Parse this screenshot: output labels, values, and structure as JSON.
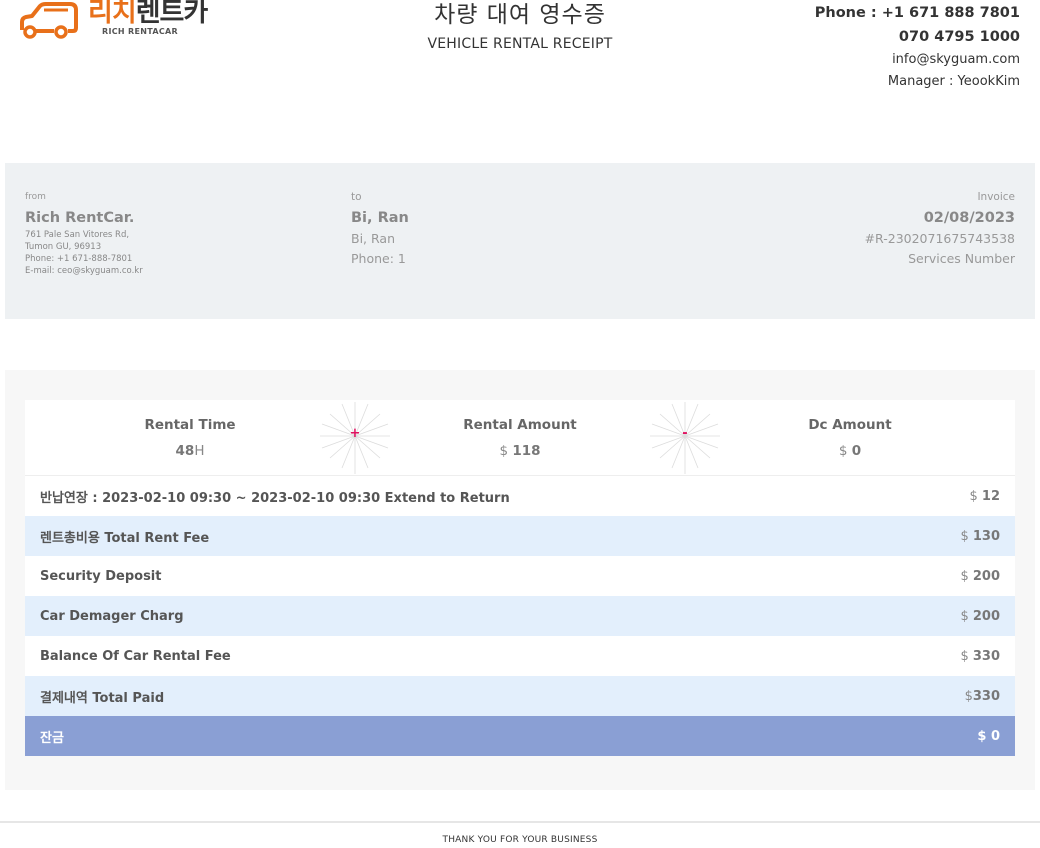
{
  "brand": {
    "name_ko_1": "리치",
    "name_ko_2": "렌트카",
    "name_en": "RICH RENTACAR",
    "accent": "#e8701a"
  },
  "header": {
    "title_ko": "차량 대여 영수증",
    "title_en": "VEHICLE RENTAL RECEIPT",
    "phone": "Phone : +1 671 888 7801",
    "phone2": "070 4795 1000",
    "email": "info@skyguam.com",
    "manager": "Manager : YeookKim"
  },
  "from": {
    "label": "from",
    "name": "Rich RentCar.",
    "address1": "761 Pale San Vitores Rd,",
    "address2": "Tumon GU, 96913",
    "phone": "Phone: +1 671-888-7801",
    "email": "E-mail: ceo@skyguam.co.kr"
  },
  "to": {
    "label": "to",
    "name": "Bi, Ran",
    "line1": "Bi, Ran",
    "phone": "Phone: 1"
  },
  "invoice": {
    "label": "Invoice",
    "date": "02/08/2023",
    "number": "#R-2302071675743538",
    "services": "Services Number"
  },
  "summary": {
    "rental_time_label": "Rental Time",
    "rental_time_value": "48",
    "rental_time_unit": "H",
    "plus": "+",
    "rental_amount_label": "Rental Amount",
    "rental_amount_currency": "$",
    "rental_amount_value": "118",
    "minus": "-",
    "dc_amount_label": "Dc Amount",
    "dc_amount_currency": "$",
    "dc_amount_value": "0"
  },
  "rows": [
    {
      "label": "반납연장 : 2023-02-10 09:30 ~ 2023-02-10 09:30 Extend to Return",
      "currency": "$",
      "amount": "12"
    },
    {
      "label": "렌트총비용 Total Rent Fee",
      "currency": "$",
      "amount": "130"
    },
    {
      "label": "Security Deposit",
      "currency": "$",
      "amount": "200"
    },
    {
      "label": "Car Demager Charg",
      "currency": "$",
      "amount": "200"
    },
    {
      "label": "Balance Of Car Rental Fee",
      "currency": "$",
      "amount": "330"
    },
    {
      "label": "결제내역 Total Paid",
      "currency": "$",
      "amount": "330"
    },
    {
      "label": "잔금",
      "currency": "$",
      "amount": "0"
    }
  ],
  "footer": {
    "text": "THANK YOU FOR YOUR BUSINESS"
  },
  "colors": {
    "row_alt": "#e3effc",
    "total_row": "#8a9fd4",
    "op_sign": "#e0115f"
  }
}
